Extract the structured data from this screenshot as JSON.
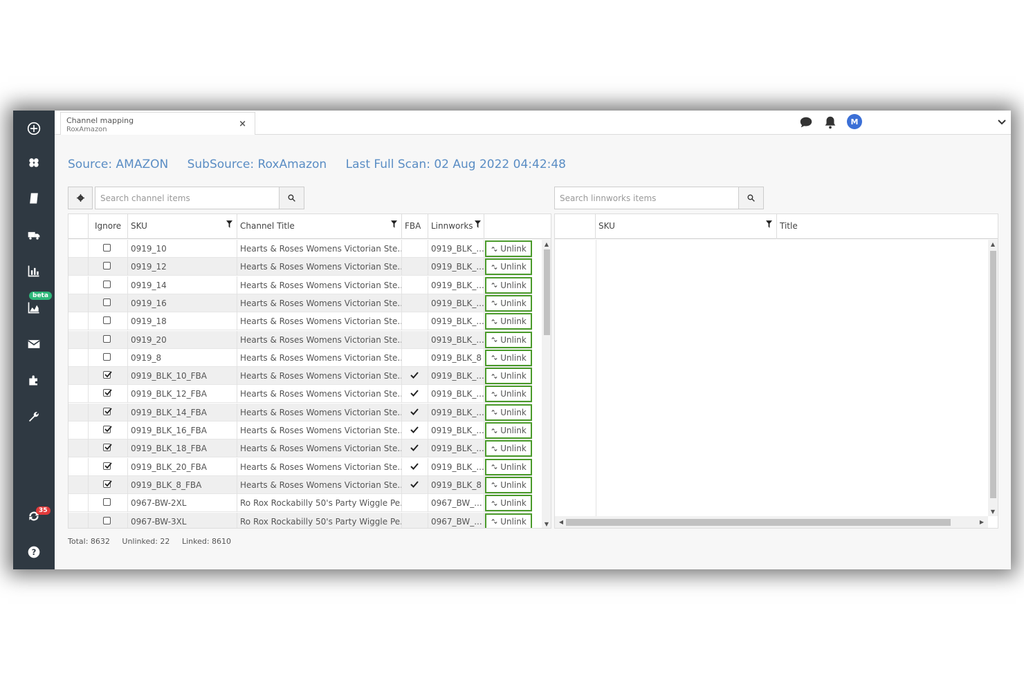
{
  "tab": {
    "title": "Channel mapping",
    "subtitle": "RoxAmazon",
    "close": "×"
  },
  "user": {
    "initial": "M"
  },
  "sidebar": {
    "beta_label": "beta",
    "sync_count": "35"
  },
  "header": {
    "source": "Source: AMAZON",
    "subsource": "SubSource: RoxAmazon",
    "last_scan": "Last Full Scan: 02 Aug 2022 04:42:48"
  },
  "channel_search": {
    "placeholder": "Search channel items"
  },
  "linnworks_search": {
    "placeholder": "Search linnworks items"
  },
  "channel_grid": {
    "columns": {
      "ignore": "Ignore",
      "sku": "SKU",
      "title": "Channel Title",
      "fba": "FBA",
      "linnworks": "Linnworks"
    },
    "action_label": "Unlink",
    "rows": [
      {
        "ignore": false,
        "sku": "0919_10",
        "title": "Hearts & Roses Womens Victorian Ste...",
        "fba": false,
        "linnworks": "0919_BLK_..."
      },
      {
        "ignore": false,
        "sku": "0919_12",
        "title": "Hearts & Roses Womens Victorian Ste...",
        "fba": false,
        "linnworks": "0919_BLK_..."
      },
      {
        "ignore": false,
        "sku": "0919_14",
        "title": "Hearts & Roses Womens Victorian Ste...",
        "fba": false,
        "linnworks": "0919_BLK_..."
      },
      {
        "ignore": false,
        "sku": "0919_16",
        "title": "Hearts & Roses Womens Victorian Ste...",
        "fba": false,
        "linnworks": "0919_BLK_..."
      },
      {
        "ignore": false,
        "sku": "0919_18",
        "title": "Hearts & Roses Womens Victorian Ste...",
        "fba": false,
        "linnworks": "0919_BLK_..."
      },
      {
        "ignore": false,
        "sku": "0919_20",
        "title": "Hearts & Roses Womens Victorian Ste...",
        "fba": false,
        "linnworks": "0919_BLK_..."
      },
      {
        "ignore": false,
        "sku": "0919_8",
        "title": "Hearts & Roses Womens Victorian Ste...",
        "fba": false,
        "linnworks": "0919_BLK_8"
      },
      {
        "ignore": true,
        "sku": "0919_BLK_10_FBA",
        "title": "Hearts & Roses Womens Victorian Ste...",
        "fba": true,
        "linnworks": "0919_BLK_..."
      },
      {
        "ignore": true,
        "sku": "0919_BLK_12_FBA",
        "title": "Hearts & Roses Womens Victorian Ste...",
        "fba": true,
        "linnworks": "0919_BLK_..."
      },
      {
        "ignore": true,
        "sku": "0919_BLK_14_FBA",
        "title": "Hearts & Roses Womens Victorian Ste...",
        "fba": true,
        "linnworks": "0919_BLK_..."
      },
      {
        "ignore": true,
        "sku": "0919_BLK_16_FBA",
        "title": "Hearts & Roses Womens Victorian Ste...",
        "fba": true,
        "linnworks": "0919_BLK_..."
      },
      {
        "ignore": true,
        "sku": "0919_BLK_18_FBA",
        "title": "Hearts & Roses Womens Victorian Ste...",
        "fba": true,
        "linnworks": "0919_BLK_..."
      },
      {
        "ignore": true,
        "sku": "0919_BLK_20_FBA",
        "title": "Hearts & Roses Womens Victorian Ste...",
        "fba": true,
        "linnworks": "0919_BLK_..."
      },
      {
        "ignore": true,
        "sku": "0919_BLK_8_FBA",
        "title": "Hearts & Roses Womens Victorian Ste...",
        "fba": true,
        "linnworks": "0919_BLK_8"
      },
      {
        "ignore": false,
        "sku": "0967-BW-2XL",
        "title": "Ro Rox Rockabilly 50's Party Wiggle Pe...",
        "fba": false,
        "linnworks": "0967_BW_..."
      },
      {
        "ignore": false,
        "sku": "0967-BW-3XL",
        "title": "Ro Rox Rockabilly 50's Party Wiggle Pe...",
        "fba": false,
        "linnworks": "0967_BW_..."
      }
    ]
  },
  "linnworks_grid": {
    "columns": {
      "sku": "SKU",
      "title": "Title"
    }
  },
  "footer": {
    "total": "Total: 8632",
    "unlinked": "Unlinked: 22",
    "linked": "Linked: 8610"
  }
}
